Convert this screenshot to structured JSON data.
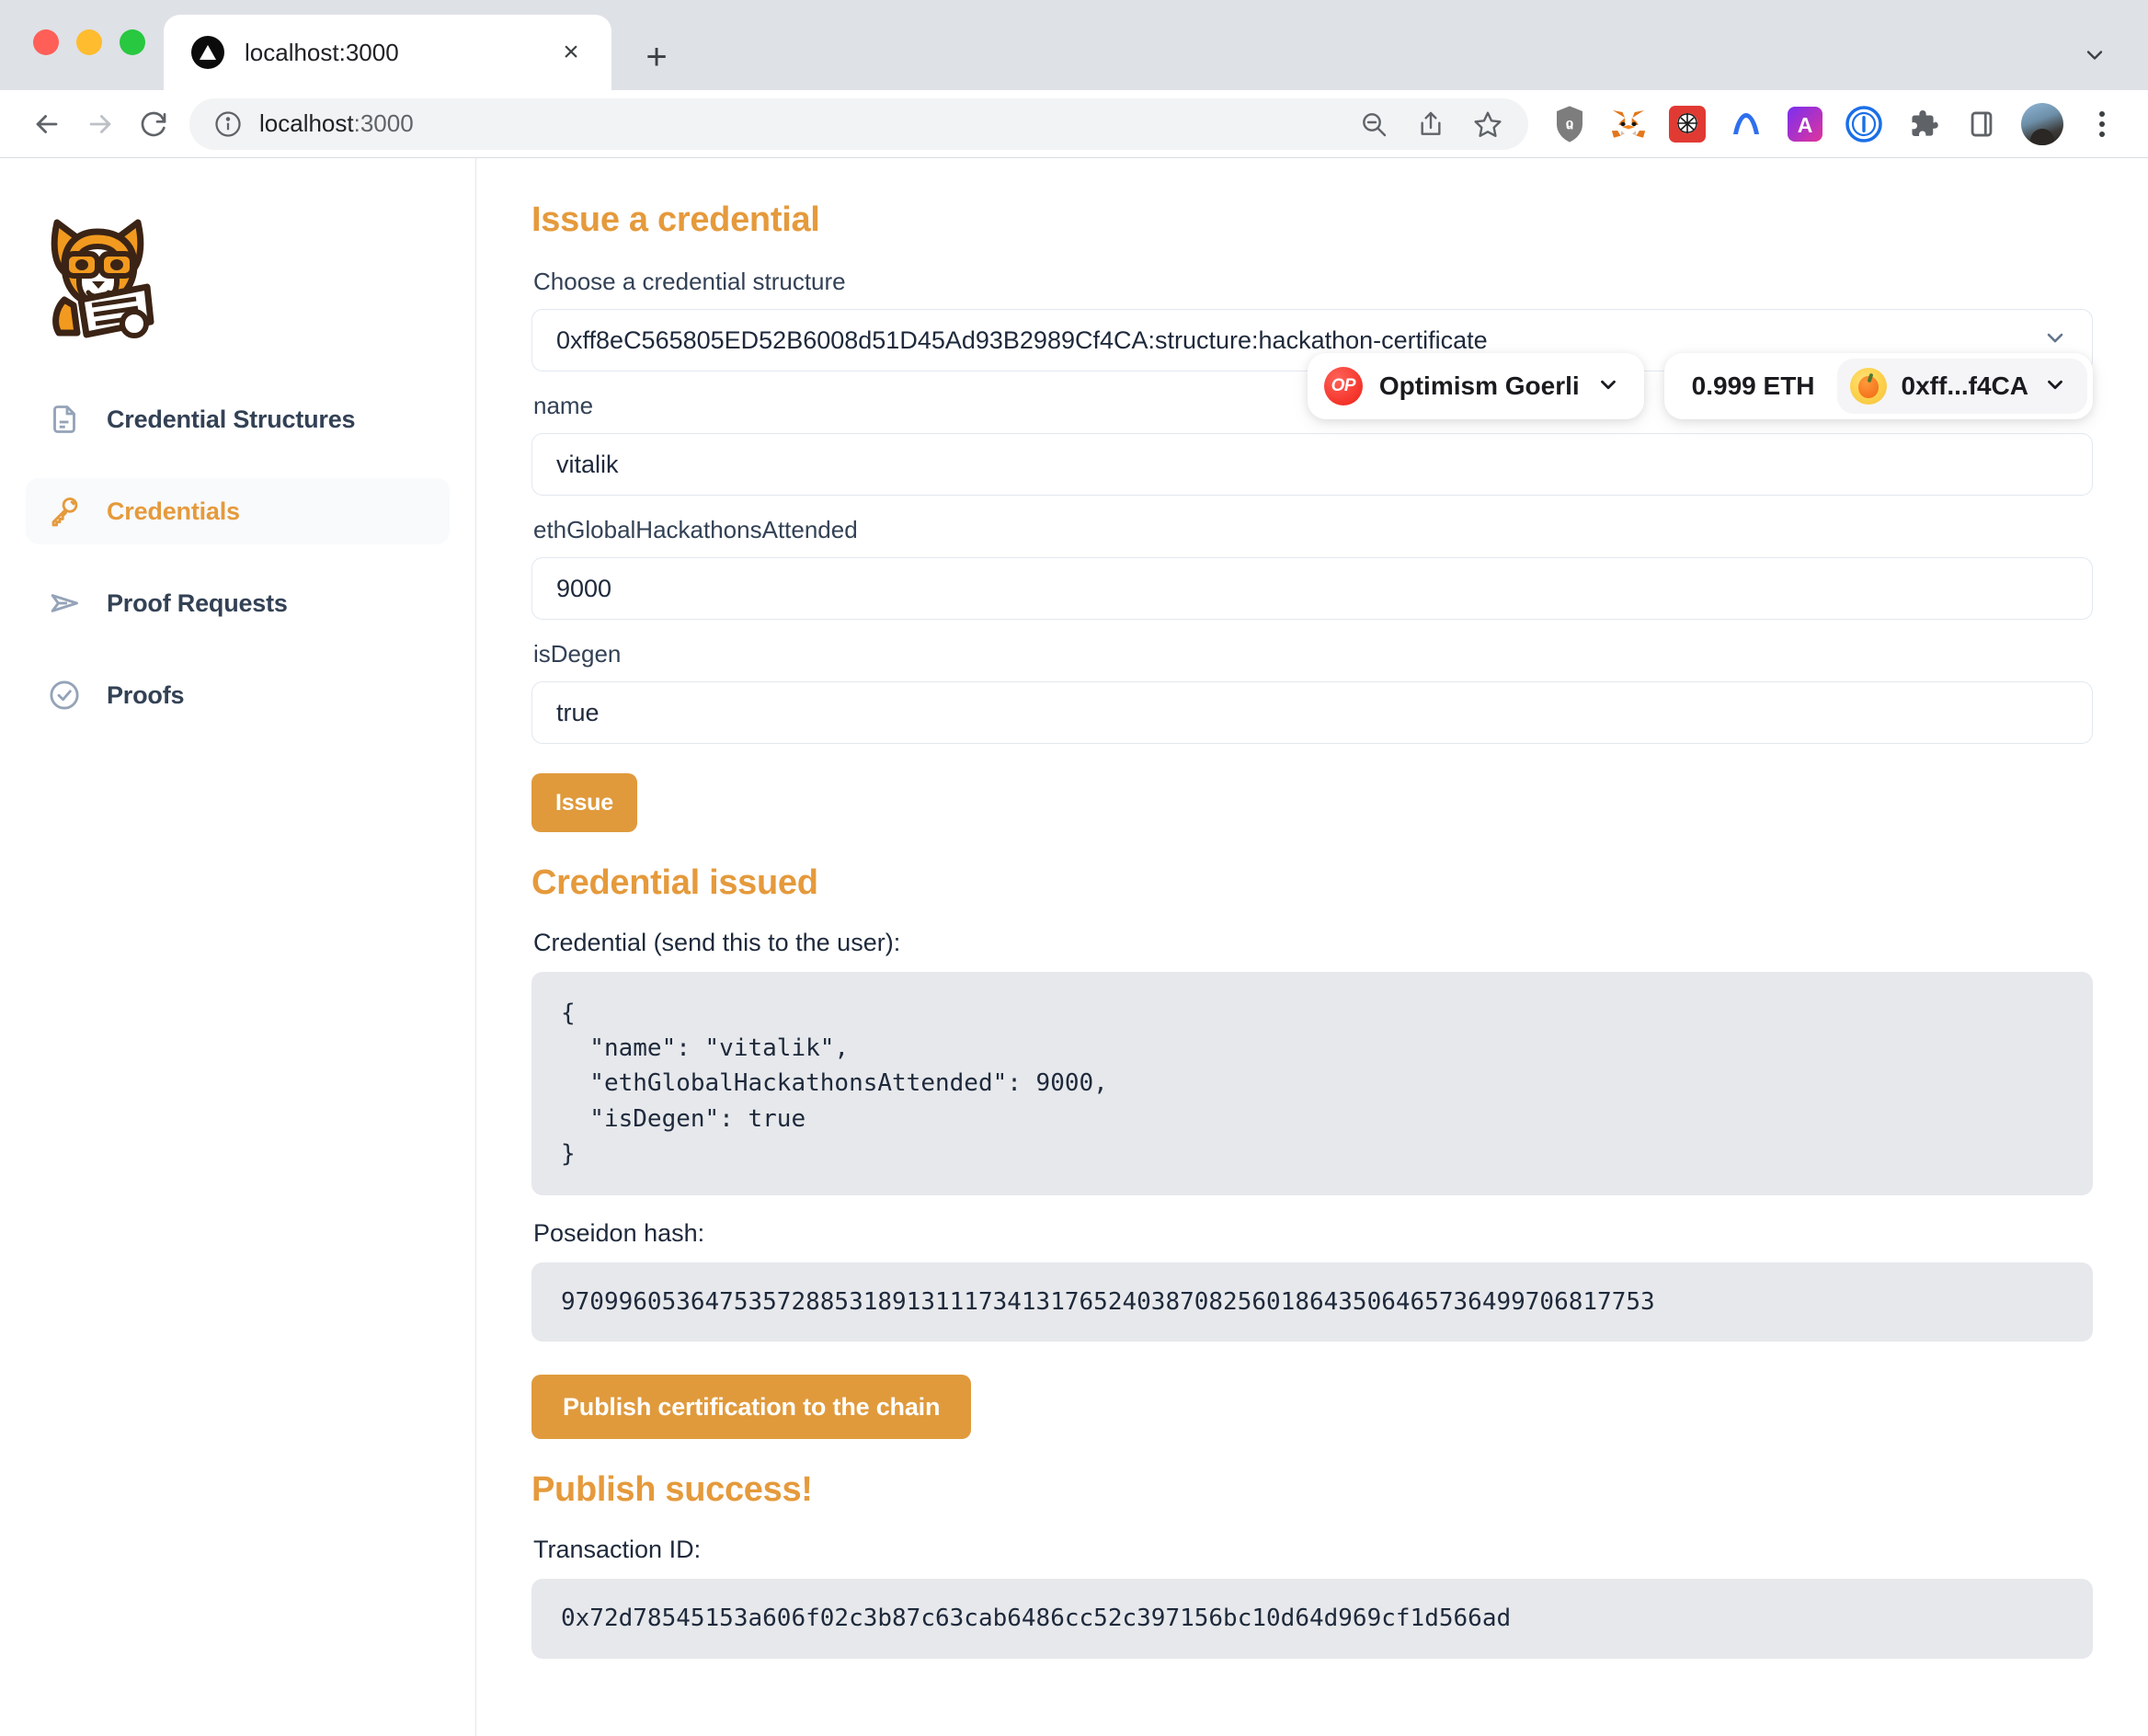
{
  "browser": {
    "tab": {
      "title": "localhost:3000",
      "favicon": "nextjs-triangle-icon",
      "close": "×"
    },
    "new_tab": "+",
    "url_host": "localhost",
    "url_port": ":3000",
    "extensions": [
      "ublock-origin-icon",
      "metamask-icon",
      "rabby-wallet-icon",
      "arc-icon",
      "alby-icon",
      "onepassword-icon",
      "extensions-puzzle-icon",
      "side-panel-icon"
    ],
    "omni_actions": [
      "zoom-out-icon",
      "share-icon",
      "bookmark-star-icon"
    ],
    "nav": [
      "back-icon",
      "forward-icon",
      "reload-icon"
    ]
  },
  "sidebar": {
    "logo": "corgi-reading-document-logo",
    "items": [
      {
        "label": "Credential Structures",
        "icon": "document-icon",
        "active": false
      },
      {
        "label": "Credentials",
        "icon": "key-icon",
        "active": true
      },
      {
        "label": "Proof Requests",
        "icon": "paper-plane-icon",
        "active": false
      },
      {
        "label": "Proofs",
        "icon": "check-circle-icon",
        "active": false
      }
    ]
  },
  "wallet": {
    "chain_badge": "OP",
    "chain_name": "Optimism Goerli",
    "balance": "0.999 ETH",
    "account": "0xff...f4CA",
    "chevron": "chevron-down-icon"
  },
  "issue": {
    "heading": "Issue a credential",
    "structure_label": "Choose a credential structure",
    "structure_value": "0xff8eC565805ED52B6008d51D45Ad93B2989Cf4CA:structure:hackathon-certificate",
    "fields": [
      {
        "label": "name",
        "value": "vitalik"
      },
      {
        "label": "ethGlobalHackathonsAttended",
        "value": "9000"
      },
      {
        "label": "isDegen",
        "value": "true"
      }
    ],
    "submit_label": "Issue"
  },
  "issued": {
    "heading": "Credential issued",
    "credential_label": "Credential (send this to the user):",
    "credential_json": "{\n  \"name\": \"vitalik\",\n  \"ethGlobalHackathonsAttended\": 9000,\n  \"isDegen\": true\n}",
    "poseidon_label": "Poseidon hash:",
    "poseidon_hash": "9709960536475357288531891311173413176524038708256018643506465736499706817753",
    "publish_label": "Publish certification to the chain"
  },
  "published": {
    "heading": "Publish success!",
    "tx_label": "Transaction ID:",
    "tx_id": "0x72d78545153a606f02c3b87c63cab6486cc52c397156bc10d64d969cf1d566ad"
  },
  "colors": {
    "accent": "#e59a3c",
    "button": "#e09a3c",
    "text": "#1e293b",
    "code_bg": "#e6e8eb",
    "op_red": "#f4342a"
  }
}
